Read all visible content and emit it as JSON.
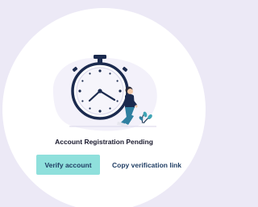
{
  "dialog": {
    "title": "Account Registration Pending",
    "illustration": "stopwatch-waiting-person"
  },
  "actions": {
    "verify_label": "Verify account",
    "copy_label": "Copy verification link"
  },
  "colors": {
    "page_background": "#ece9f6",
    "card_background": "#ffffff",
    "primary_button": "#8fe0dc",
    "text_dark": "#1f3d63",
    "illustration_navy": "#1b2a4e"
  }
}
